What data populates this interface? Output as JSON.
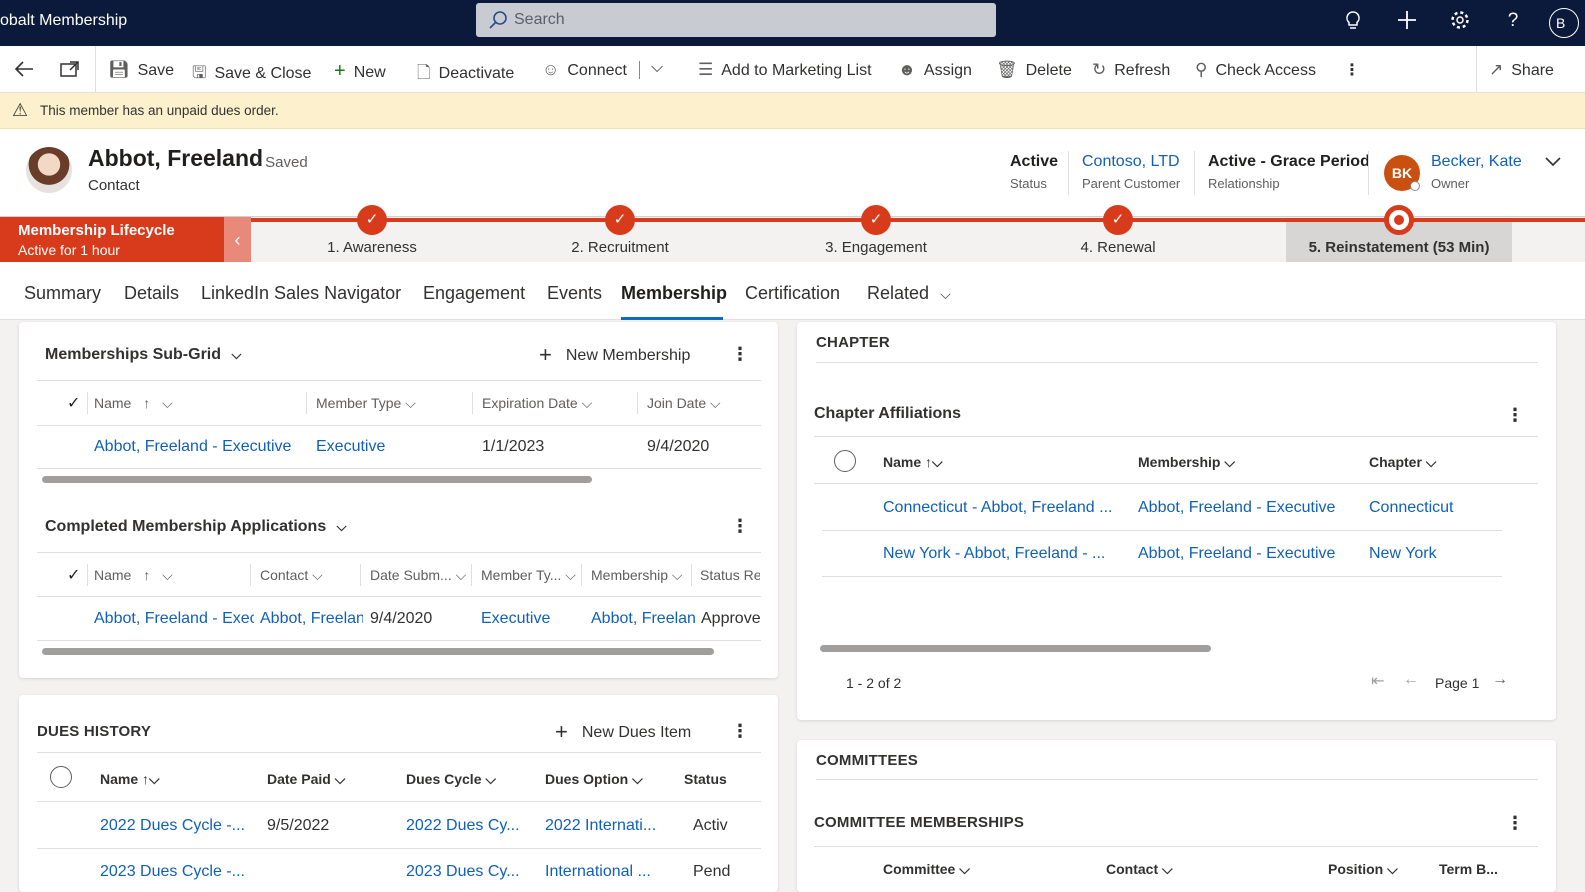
{
  "app": {
    "title": "obalt Membership"
  },
  "search": {
    "placeholder": "Search"
  },
  "topbar": {
    "icons": [
      "lightbulb-icon",
      "plus-icon",
      "gear-icon",
      "help-icon"
    ],
    "user_initial": "B"
  },
  "commands": {
    "save": "Save",
    "save_close": "Save & Close",
    "new": "New",
    "deactivate": "Deactivate",
    "connect": "Connect",
    "add_marketing": "Add to Marketing List",
    "assign": "Assign",
    "delete": "Delete",
    "refresh": "Refresh",
    "check_access": "Check Access",
    "share": "Share"
  },
  "notice": {
    "text": "This member has an unpaid dues order."
  },
  "record": {
    "name": "Abbot, Freeland",
    "saved": "- Saved",
    "type": "Contact",
    "status_value": "Active",
    "status_label": "Status",
    "parent_value": "Contoso, LTD",
    "parent_label": "Parent Customer",
    "relationship_value": "Active - Grace Period",
    "relationship_label": "Relationship",
    "owner_initials": "BK",
    "owner_value": "Becker, Kate",
    "owner_label": "Owner"
  },
  "bpf": {
    "title": "Membership Lifecycle",
    "subtitle": "Active for 1 hour",
    "stages": [
      {
        "label": "1. Awareness"
      },
      {
        "label": "2. Recruitment"
      },
      {
        "label": "3. Engagement"
      },
      {
        "label": "4. Renewal"
      },
      {
        "label": "5. Reinstatement  (53 Min)"
      }
    ],
    "accent": "#d83b1c"
  },
  "tabs": [
    "Summary",
    "Details",
    "LinkedIn Sales Navigator",
    "Engagement",
    "Events",
    "Membership",
    "Certification",
    "Related"
  ],
  "memberships": {
    "title": "Memberships Sub-Grid",
    "new_label": "New Membership",
    "columns": [
      "Name",
      "Member Type",
      "Expiration Date",
      "Join Date"
    ],
    "rows": [
      [
        "Abbot, Freeland - Executive",
        "Executive",
        "1/1/2023",
        "9/4/2020"
      ]
    ]
  },
  "applications": {
    "title": "Completed Membership Applications",
    "columns": [
      "Name",
      "Contact",
      "Date Subm...",
      "Member Ty...",
      "Membership",
      "Status Rea"
    ],
    "rows": [
      [
        "Abbot, Freeland - Executive",
        "Abbot, Freeland",
        "9/4/2020",
        "Executive",
        "Abbot, Freeland",
        "Approved"
      ]
    ]
  },
  "dues": {
    "title": "DUES HISTORY",
    "new_label": "New Dues Item",
    "columns": [
      "Name",
      "Date Paid",
      "Dues Cycle",
      "Dues Option",
      "Status"
    ],
    "rows": [
      [
        "2022 Dues Cycle -...",
        "9/5/2022",
        "2022 Dues Cy...",
        "2022 Internati...",
        "Activ"
      ],
      [
        "2023 Dues Cycle -...",
        "",
        "2023 Dues Cy...",
        "International ...",
        "Pend"
      ]
    ]
  },
  "chapter": {
    "section": "CHAPTER",
    "title": "Chapter Affiliations",
    "columns": [
      "Name",
      "Membership",
      "Chapter"
    ],
    "rows": [
      [
        "Connecticut - Abbot, Freeland ...",
        "Abbot, Freeland - Executive",
        "Connecticut"
      ],
      [
        "New York - Abbot, Freeland - ...",
        "Abbot, Freeland - Executive",
        "New York"
      ]
    ],
    "count": "1 - 2 of 2",
    "page": "Page 1"
  },
  "committees": {
    "section": "COMMITTEES",
    "title": "COMMITTEE MEMBERSHIPS",
    "columns": [
      "Committee",
      "Contact",
      "Position",
      "Term B..."
    ]
  }
}
